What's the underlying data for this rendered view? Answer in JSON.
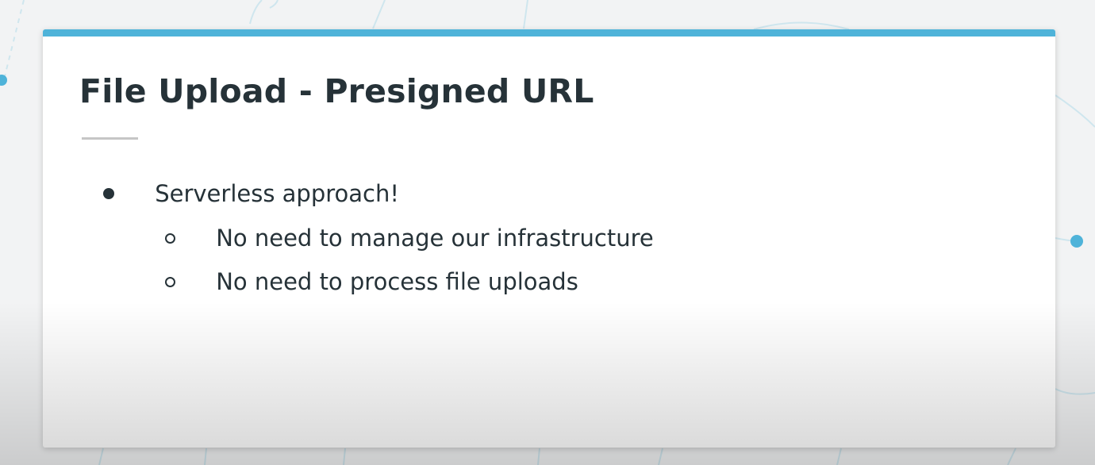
{
  "slide": {
    "title": "File Upload - Presigned URL",
    "bullets": [
      {
        "text": "Serverless approach!",
        "marker": "disc",
        "children": [
          {
            "text": "No need to manage our infrastructure",
            "marker": "circle"
          },
          {
            "text": "No need to process file uploads",
            "marker": "circle"
          }
        ]
      }
    ]
  },
  "colors": {
    "accent": "#4fb3d9",
    "text": "#263238",
    "background": "#f2f3f4"
  }
}
